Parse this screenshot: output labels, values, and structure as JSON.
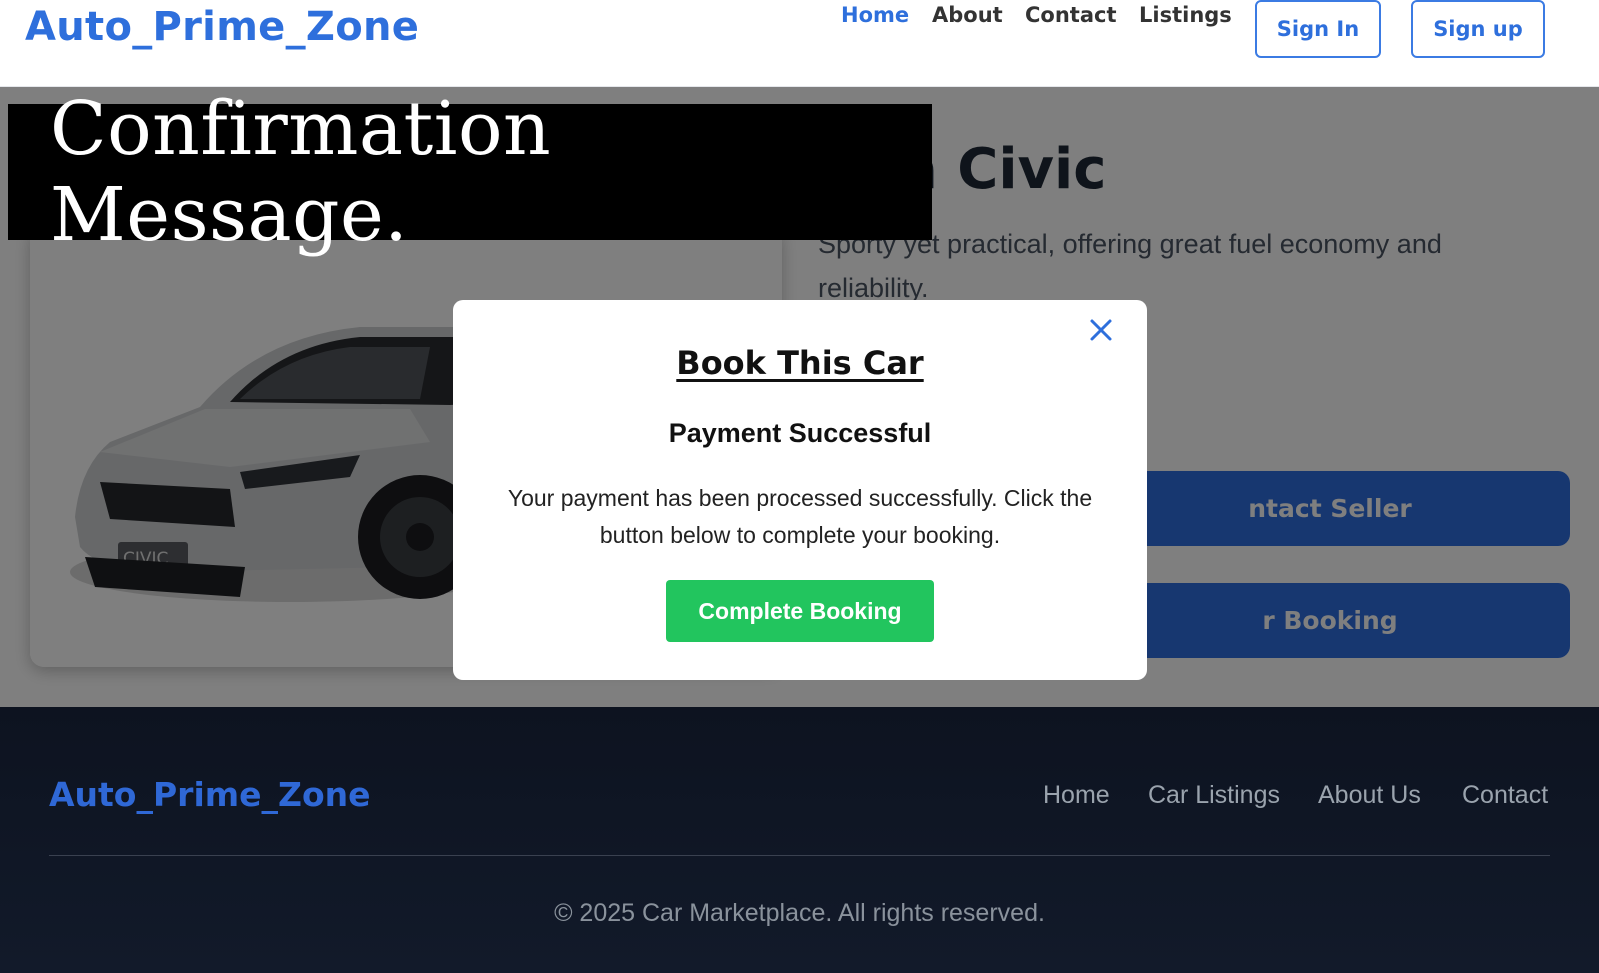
{
  "header": {
    "logo": "Auto_Prime_Zone",
    "nav": [
      {
        "label": "Home"
      },
      {
        "label": "About"
      },
      {
        "label": "Contact"
      },
      {
        "label": "Listings"
      }
    ],
    "sign_in": "Sign In",
    "sign_up": "Sign up"
  },
  "banner": {
    "text": "Confirmation Message."
  },
  "car": {
    "title_visible": "nda Civic",
    "badge_text": "CIVIC",
    "description": "Sporty yet practical, offering great fuel economy and reliability.",
    "contact_button_visible": "ntact Seller",
    "booking_button_visible": "r Booking"
  },
  "modal": {
    "title": "Book This Car",
    "subtitle": "Payment Successful",
    "message": "Your payment has been processed successfully. Click the button below to complete your booking.",
    "button": "Complete Booking",
    "close_icon": "close-icon"
  },
  "footer": {
    "logo": "Auto_Prime_Zone",
    "links": [
      {
        "label": "Home"
      },
      {
        "label": "Car Listings"
      },
      {
        "label": "About Us"
      },
      {
        "label": "Contact"
      }
    ],
    "copyright": "© 2025 Car Marketplace. All rights reserved."
  },
  "colors": {
    "brand_blue": "#2e6fdc",
    "success_green": "#22c55e",
    "footer_bg": "#0d1320"
  }
}
